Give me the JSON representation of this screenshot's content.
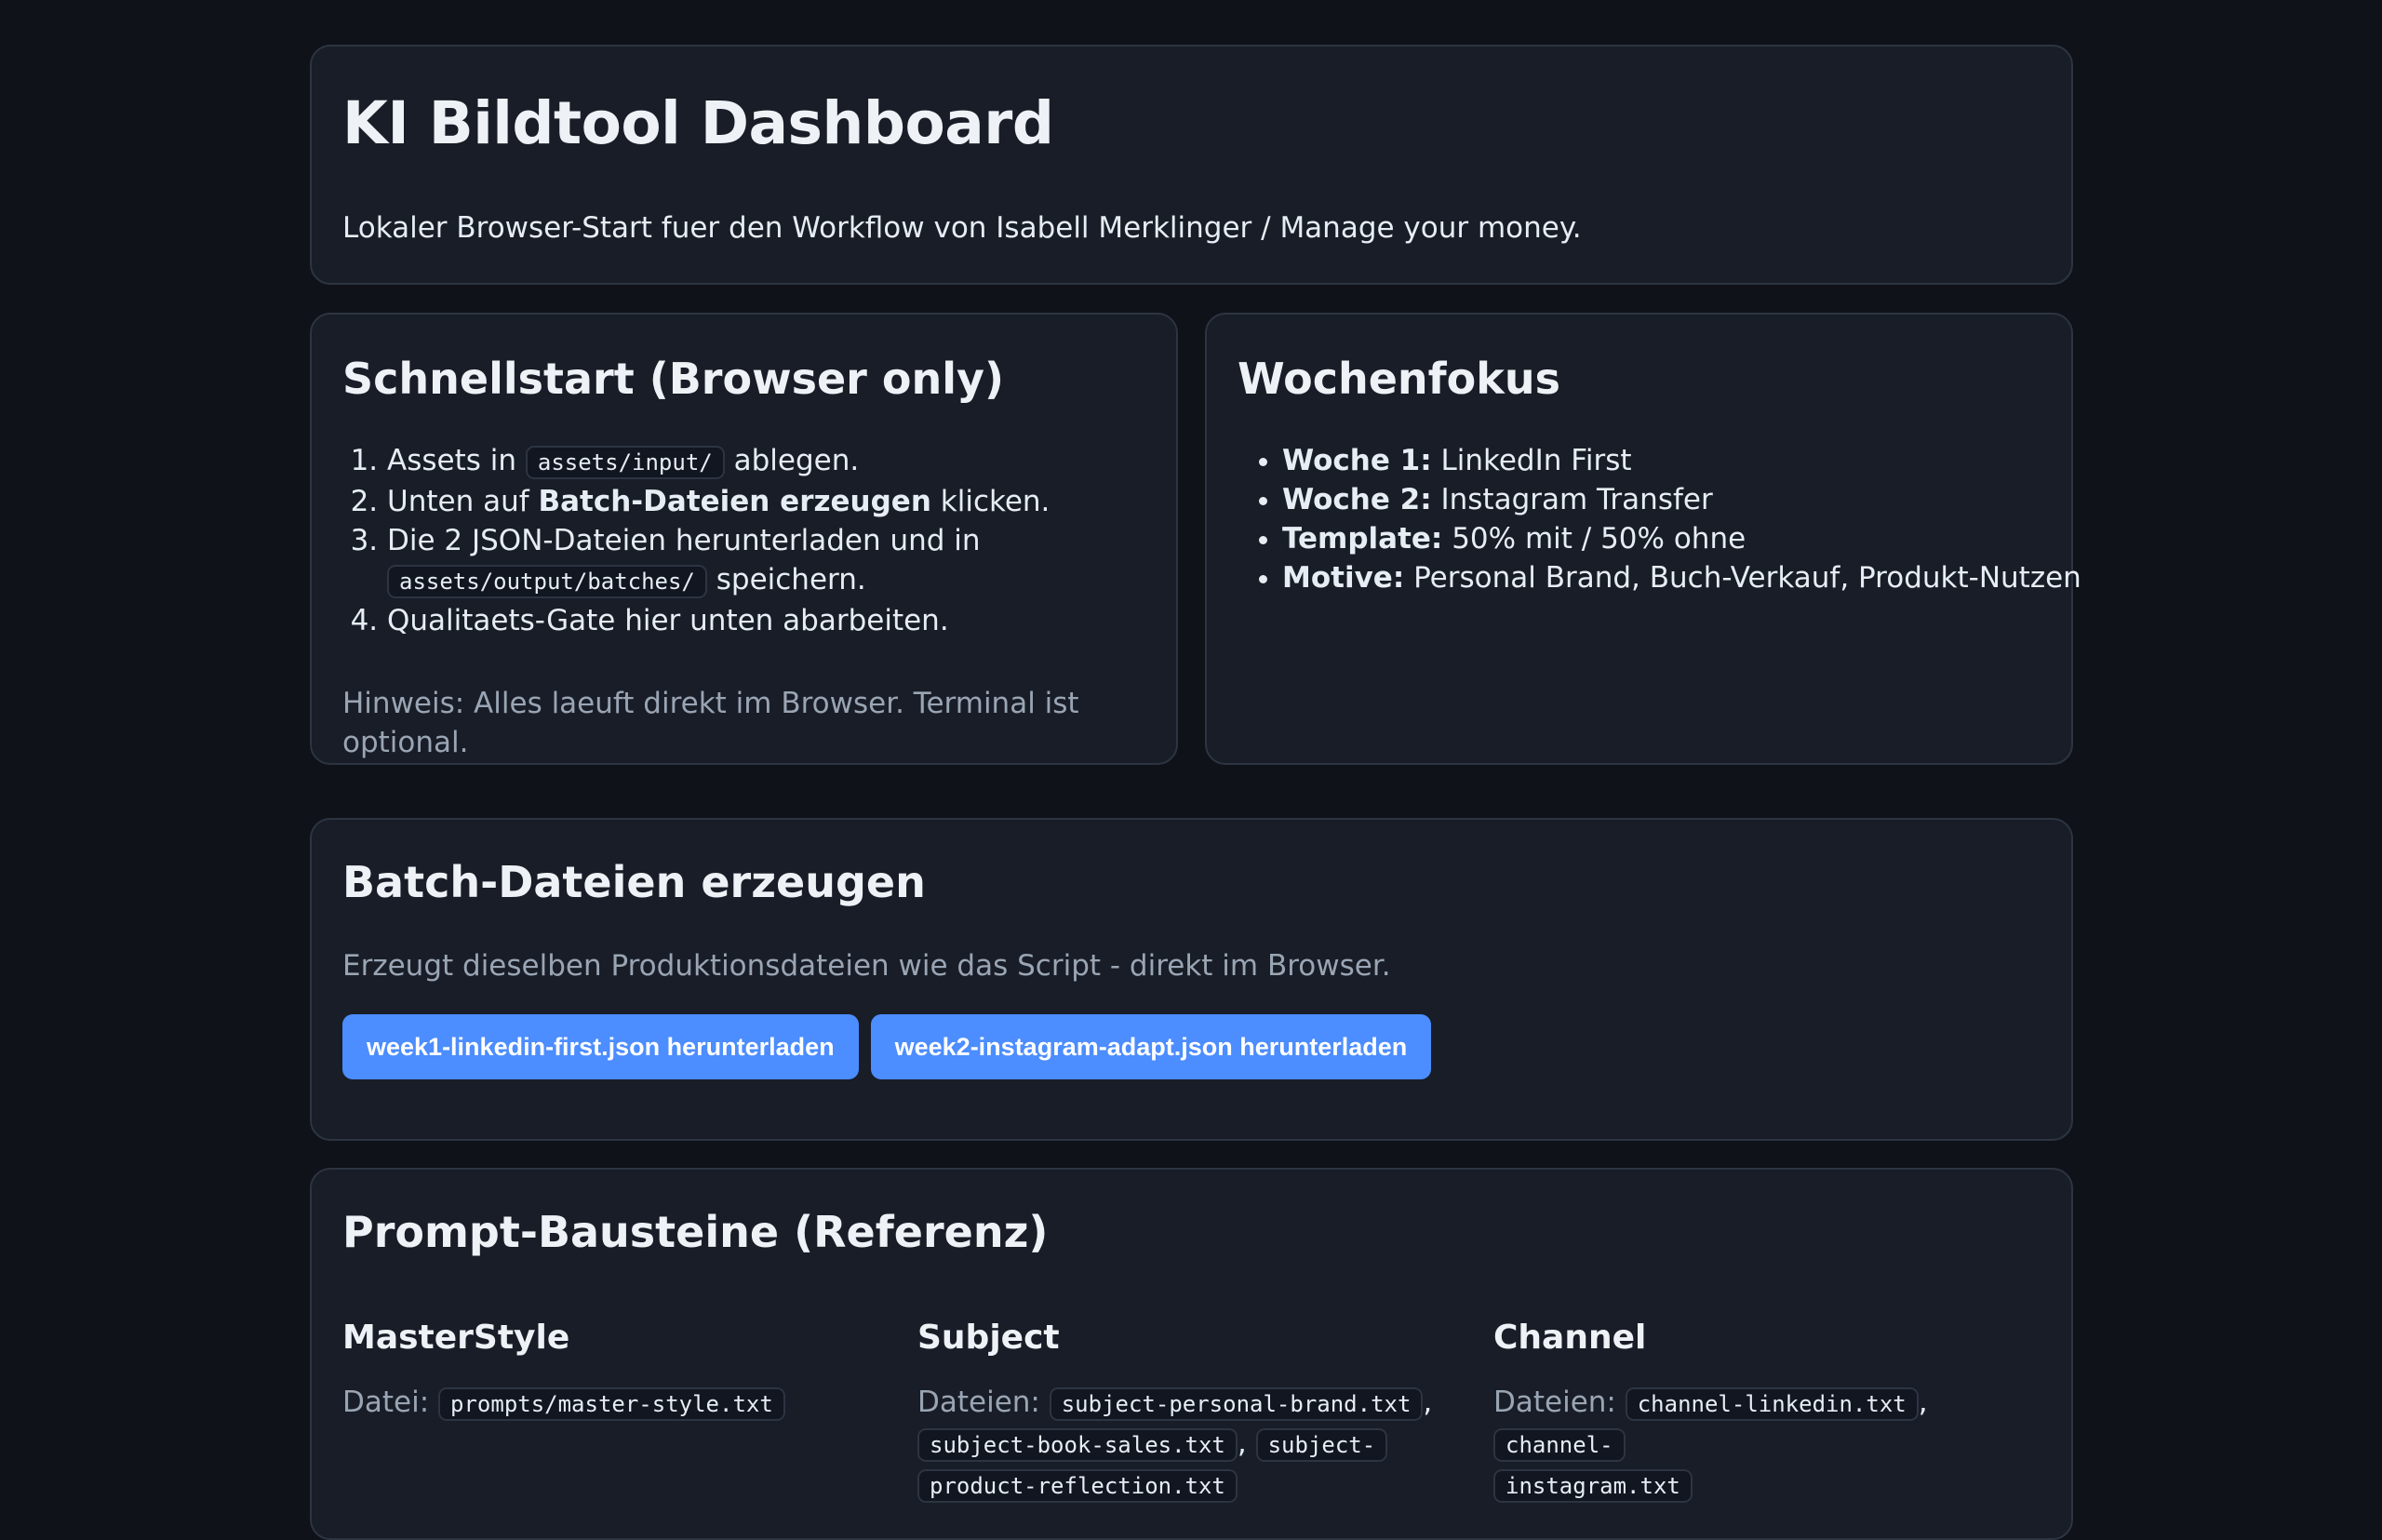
{
  "header": {
    "title": "KI Bildtool Dashboard",
    "subtitle": "Lokaler Browser-Start fuer den Workflow von Isabell Merklinger / Manage your money."
  },
  "quickstart": {
    "title": "Schnellstart (Browser only)",
    "step1_a": "Assets in",
    "step1_code": "assets/input/",
    "step1_b": "ablegen.",
    "step2_a": "Unten auf",
    "step2_bold": "Batch-Dateien erzeugen",
    "step2_b": "klicken.",
    "step3_a": "Die 2 JSON-Dateien herunterladen und in",
    "step3_code": "assets/output/batches/",
    "step3_b": "speichern.",
    "step4": "Qualitaets-Gate hier unten abarbeiten.",
    "note": "Hinweis: Alles laeuft direkt im Browser. Terminal ist optional."
  },
  "focus": {
    "title": "Wochenfokus",
    "items": [
      {
        "label": "Woche 1:",
        "value": "LinkedIn First"
      },
      {
        "label": "Woche 2:",
        "value": "Instagram Transfer"
      },
      {
        "label": "Template:",
        "value": "50% mit / 50% ohne"
      },
      {
        "label": "Motive:",
        "value": "Personal Brand, Buch-Verkauf, Produkt-Nutzen"
      }
    ]
  },
  "batch": {
    "title": "Batch-Dateien erzeugen",
    "description": "Erzeugt dieselben Produktionsdateien wie das Script - direkt im Browser.",
    "button1": "week1-linkedin-first.json herunterladen",
    "button2": "week2-instagram-adapt.json herunterladen"
  },
  "prompts": {
    "title": "Prompt-Bausteine (Referenz)",
    "master": {
      "title": "MasterStyle",
      "label": "Datei:",
      "file": "prompts/master-style.txt"
    },
    "subject": {
      "title": "Subject",
      "label": "Dateien:",
      "file1": "subject-personal-brand.txt",
      "file2": "subject-book-sales.txt",
      "file3_a": "subject-",
      "file3_b": "product-reflection.txt",
      "sep": ","
    },
    "channel": {
      "title": "Channel",
      "label": "Dateien:",
      "file1": "channel-linkedin.txt",
      "sep": ",",
      "file2_a": "channel-",
      "file2_b": "instagram.txt"
    }
  }
}
